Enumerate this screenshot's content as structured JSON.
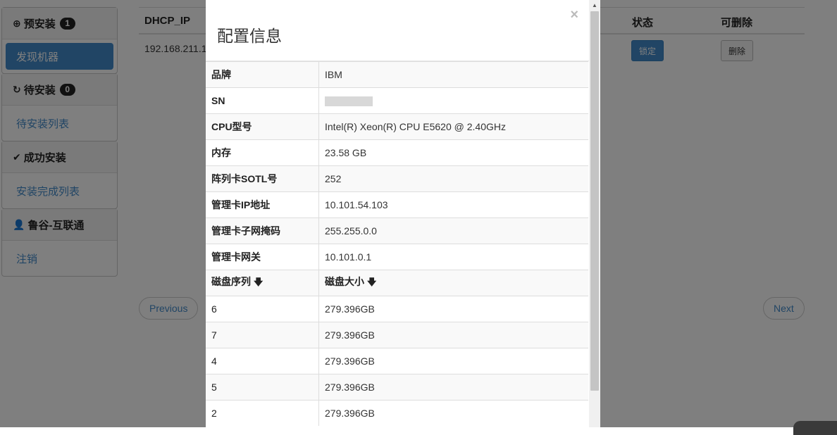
{
  "sidebar": {
    "groups": [
      {
        "title": "预安装",
        "badge": "1",
        "icon": "upload-circle-icon",
        "items": [
          {
            "label": "发现机器",
            "active": true
          }
        ]
      },
      {
        "title": "待安装",
        "badge": "0",
        "icon": "refresh-icon",
        "items": [
          {
            "label": "待安装列表"
          }
        ]
      },
      {
        "title": "成功安装",
        "icon": "check-icon",
        "items": [
          {
            "label": "安装完成列表"
          }
        ]
      },
      {
        "title": "鲁谷-互联通",
        "icon": "user-icon",
        "items": [
          {
            "label": "注销"
          }
        ]
      }
    ]
  },
  "table": {
    "headers": {
      "dhcp_ip": "DHCP_IP",
      "status": "状态",
      "deletable": "可删除"
    },
    "row": {
      "ip": "192.168.211.1",
      "lock_label": "锁定",
      "delete_label": "删除"
    }
  },
  "pagination": {
    "previous": "Previous",
    "next": "Next"
  },
  "modal": {
    "title": "配置信息",
    "close": "×",
    "rows": [
      {
        "key": "品牌",
        "value": "IBM"
      },
      {
        "key": "SN",
        "value": ""
      },
      {
        "key": "CPU型号",
        "value": "Intel(R) Xeon(R) CPU E5620 @ 2.40GHz"
      },
      {
        "key": "内存",
        "value": "23.58 GB"
      },
      {
        "key": "阵列卡SOTL号",
        "value": "252"
      },
      {
        "key": "管理卡IP地址",
        "value": "10.101.54.103"
      },
      {
        "key": "管理卡子网掩码",
        "value": "255.255.0.0"
      },
      {
        "key": "管理卡网关",
        "value": "10.101.0.1"
      }
    ],
    "disk_header": {
      "serial": "磁盘序列",
      "size": "磁盘大小"
    },
    "disks": [
      {
        "serial": "6",
        "size": "279.396GB"
      },
      {
        "serial": "7",
        "size": "279.396GB"
      },
      {
        "serial": "4",
        "size": "279.396GB"
      },
      {
        "serial": "5",
        "size": "279.396GB"
      },
      {
        "serial": "2",
        "size": "279.396GB"
      }
    ]
  }
}
